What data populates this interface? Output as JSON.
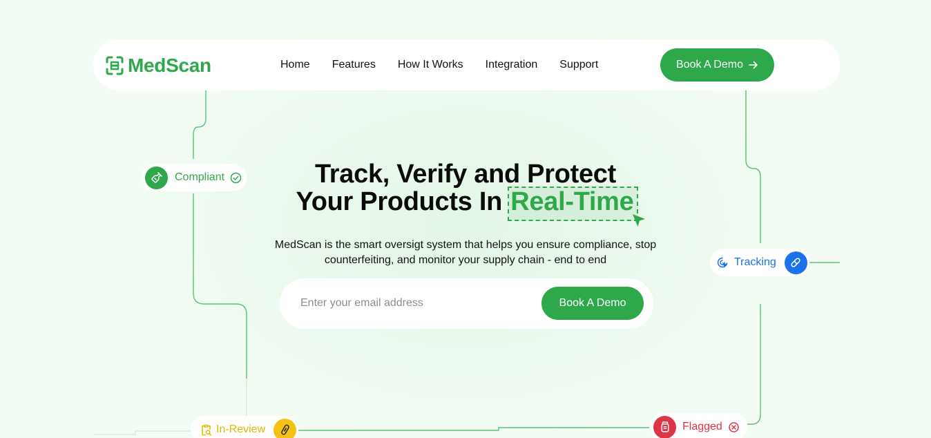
{
  "brand": {
    "name": "MedScan",
    "color": "#2ea84a"
  },
  "nav": {
    "links": [
      "Home",
      "Features",
      "How It Works",
      "Integration",
      "Support"
    ],
    "cta_label": "Book A Demo"
  },
  "hero": {
    "title_line1": "Track, Verify and Protect",
    "title_line2_prefix": "Your Products In",
    "title_highlight": "Real-Time",
    "subtitle": "MedScan is the smart oversigt system that helps you ensure compliance, stop counterfeiting, and monitor your supply chain - end to end",
    "email_placeholder": "Enter your email address",
    "form_cta_label": "Book A Demo"
  },
  "status_chips": {
    "compliant": {
      "label": "Compliant",
      "color": "#2ea84a",
      "icon": "bottle-icon",
      "end_icon": "check-circle-icon"
    },
    "tracking": {
      "label": "Tracking",
      "color": "#1a73e8",
      "icon": "tracking-cursor-icon",
      "end_icon": "pill-icon"
    },
    "in_review": {
      "label": "In-Review",
      "color": "#f2c313",
      "icon": "clipboard-search-icon",
      "end_icon": "capsule-icon"
    },
    "flagged": {
      "label": "Flagged",
      "color": "#dc3545",
      "icon": "jar-icon",
      "end_icon": "x-circle-icon"
    }
  }
}
